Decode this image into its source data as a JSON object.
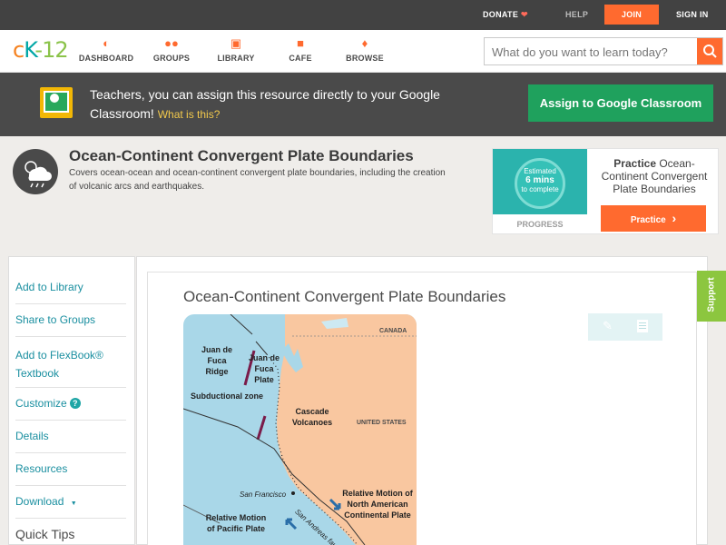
{
  "topbar": {
    "donate": "DONATE",
    "heart": "❤",
    "help": "HELP",
    "join": "JOIN",
    "signin": "SIGN IN"
  },
  "nav": {
    "logo": {
      "c": "c",
      "k": "K",
      "n": "-12"
    },
    "items": [
      {
        "label": "DASHBOARD",
        "icon": "◐"
      },
      {
        "label": "GROUPS",
        "icon": "●●"
      },
      {
        "label": "LIBRARY",
        "icon": "▣"
      },
      {
        "label": "CAFE",
        "icon": "■"
      },
      {
        "label": "BROWSE",
        "icon": "♦"
      }
    ],
    "search_placeholder": "What do you want to learn today?"
  },
  "banner": {
    "text": "Teachers, you can assign this resource directly to your Google Classroom!",
    "what": "What is this?",
    "button": "Assign to Google Classroom"
  },
  "concept": {
    "title": "Ocean-Continent Convergent Plate Boundaries",
    "description": "Covers ocean-ocean and ocean-continent convergent plate boundaries, including the creation of volcanic arcs and earthquakes."
  },
  "practice": {
    "estimated": "Estimated",
    "mins": "6 mins",
    "to_complete": "to complete",
    "progress": "PROGRESS",
    "title_bold": "Practice",
    "title_rest": "Ocean-Continent Convergent Plate Boundaries",
    "button": "Practice",
    "button_arrow": "›"
  },
  "sidebar": {
    "items": [
      "Add to Library",
      "Share to Groups",
      "Add to FlexBook®",
      "Textbook",
      "Customize",
      "Details",
      "Resources",
      "Download"
    ],
    "customize_badge": "?",
    "download_arrow": "▼",
    "quick_tips": "Quick Tips"
  },
  "main": {
    "title": "Ocean-Continent Convergent Plate Boundaries",
    "support": "Support",
    "map_labels": {
      "canada": "CANADA",
      "juan_de_fuca_ridge": "Juan de Fuca Ridge",
      "juan_de_fuca_plate": "Juan de Fuca Plate",
      "subductional_zone": "Subductional zone",
      "cascade": "Cascade Volcanoes",
      "usa": "UNITED STATES",
      "sf": "San Francisco",
      "san_andreas": "San Andreas fault",
      "na_motion": "Relative Motion of North American Continental Plate",
      "pac_motion": "Relative Motion of Pacific Plate"
    }
  },
  "colors": {
    "orange": "#ff6a2f",
    "teal_link": "#1a8fa0",
    "green_button": "#1fa15d",
    "banner": "#4a4a4a",
    "ocean": "#a9d7e8",
    "land": "#f9c7a0"
  }
}
